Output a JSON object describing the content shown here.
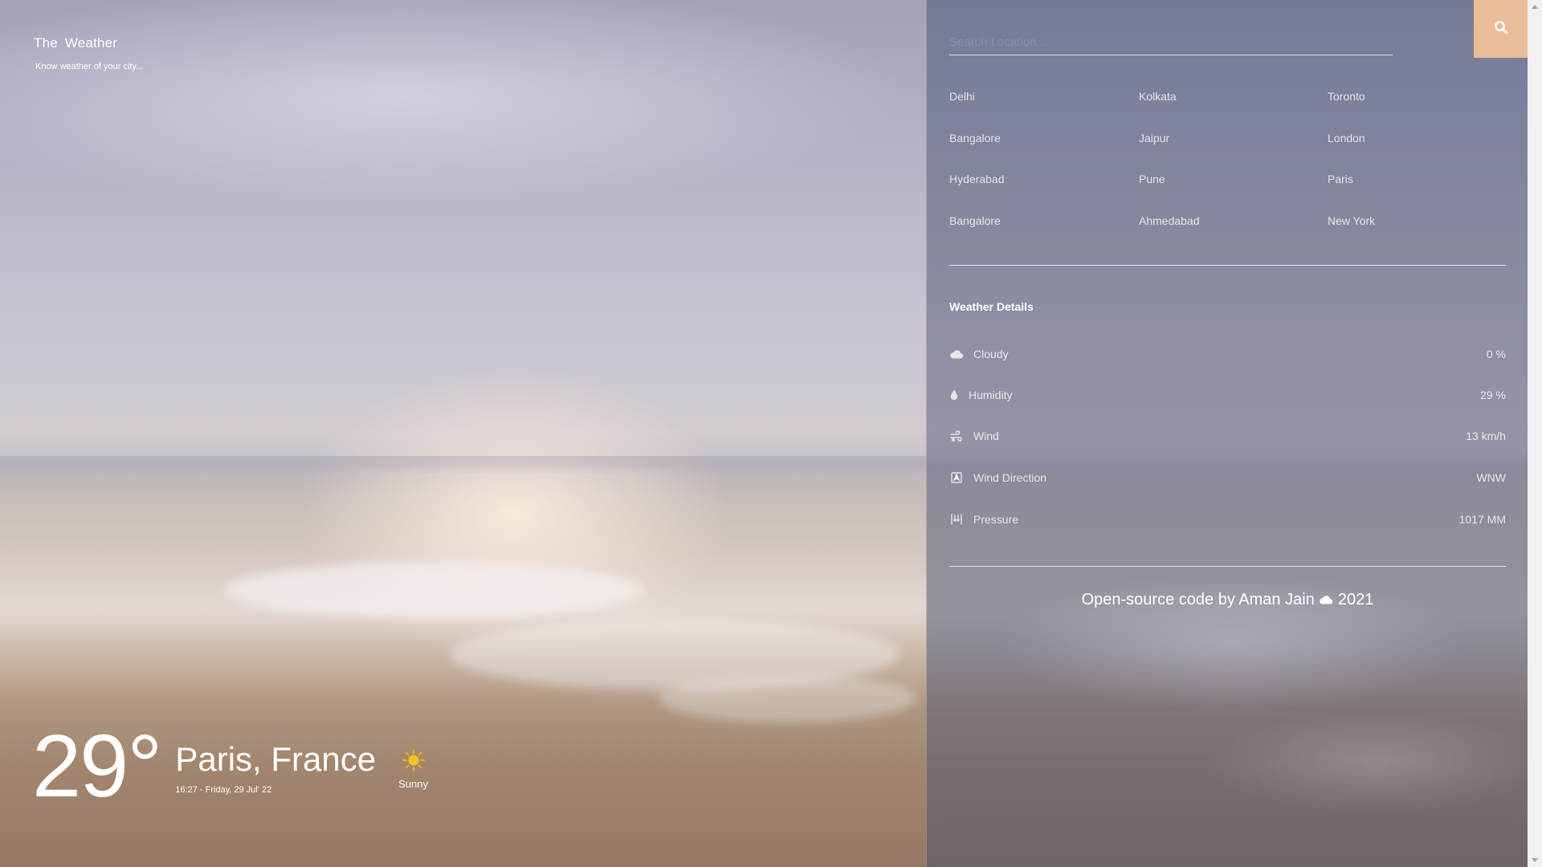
{
  "brand": {
    "title": "The  Weather",
    "tagline": "Know weather of your city..."
  },
  "current": {
    "temperature": "29°",
    "city": "Paris, France",
    "datetime": "16:27 - Friday, 29 Jul' 22",
    "condition": "Sunny",
    "condition_icon": "sun-icon"
  },
  "search": {
    "placeholder": "Search Location...",
    "button_icon": "search-icon",
    "button_color": "#e8bd97"
  },
  "cities": [
    "Delhi",
    "Kolkata",
    "Toronto",
    "Bangalore",
    "Jaipur",
    "London",
    "Hyderabad",
    "Pune",
    "Paris",
    "Bangalore",
    "Ahmedabad",
    "New York"
  ],
  "details": {
    "title": "Weather Details",
    "rows": [
      {
        "icon": "cloud-icon",
        "label": "Cloudy",
        "value": "0 %"
      },
      {
        "icon": "droplet-icon",
        "label": "Humidity",
        "value": "29 %"
      },
      {
        "icon": "wind-icon",
        "label": "Wind",
        "value": "13 km/h"
      },
      {
        "icon": "compass-icon",
        "label": "Wind Direction",
        "value": "WNW"
      },
      {
        "icon": "pressure-icon",
        "label": "Pressure",
        "value": "1017 MM"
      }
    ]
  },
  "footer": {
    "text_before": "Open-source code by Aman Jain",
    "icon": "cloud-icon",
    "text_after": "2021"
  }
}
